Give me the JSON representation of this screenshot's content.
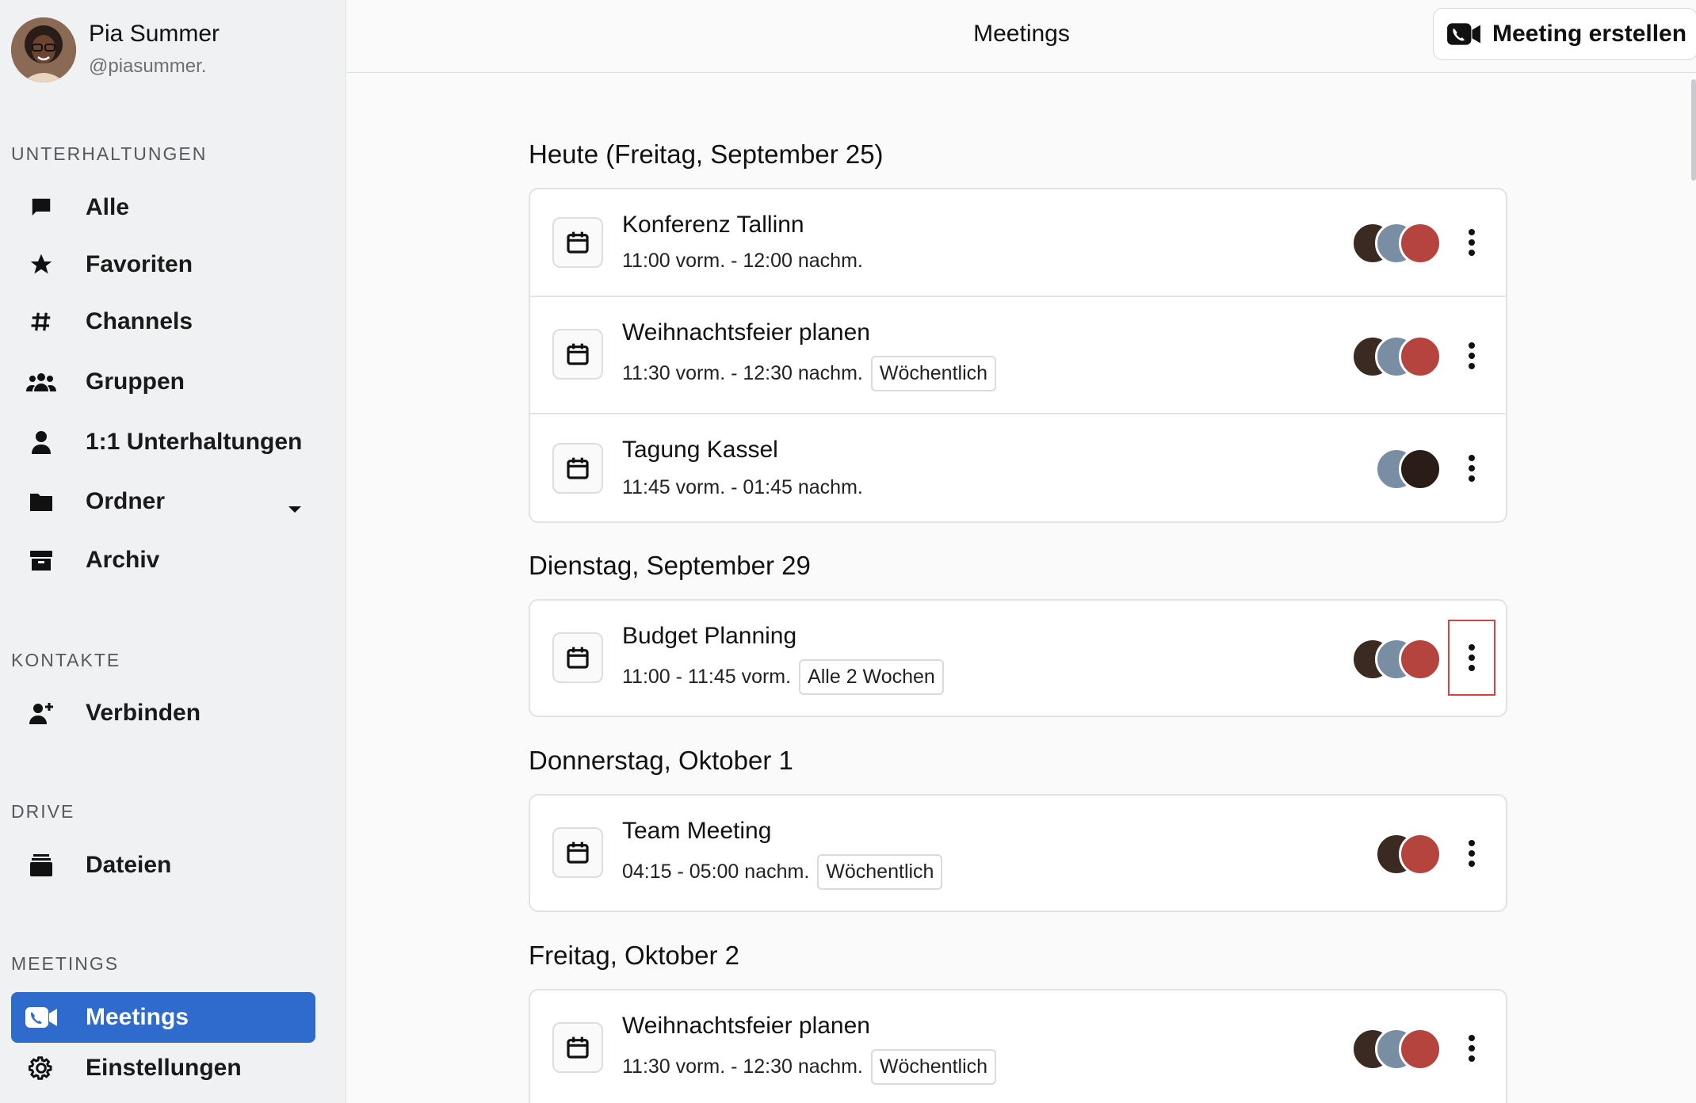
{
  "profile": {
    "name": "Pia Summer",
    "handle": "@piasummer."
  },
  "sidebar": {
    "sections": {
      "conversations": "UNTERHALTUNGEN",
      "contacts": "KONTAKTE",
      "drive": "DRIVE",
      "meetings": "MEETINGS"
    },
    "items": [
      {
        "label": "Alle",
        "icon": "chat-bubble-icon"
      },
      {
        "label": "Favoriten",
        "icon": "star-icon"
      },
      {
        "label": "Channels",
        "icon": "hash-icon"
      },
      {
        "label": "Gruppen",
        "icon": "group-icon"
      },
      {
        "label": "1:1 Unterhaltungen",
        "icon": "person-icon"
      },
      {
        "label": "Ordner",
        "icon": "folder-icon"
      },
      {
        "label": "Archiv",
        "icon": "archive-icon"
      },
      {
        "label": "Verbinden",
        "icon": "add-person-icon"
      },
      {
        "label": "Dateien",
        "icon": "files-icon"
      },
      {
        "label": "Meetings",
        "icon": "video-call-icon",
        "active": true
      },
      {
        "label": "Einstellungen",
        "icon": "gear-icon"
      }
    ]
  },
  "header": {
    "title": "Meetings",
    "create_button": "Meeting erstellen"
  },
  "days": [
    {
      "title": "Heute (Freitag, September 25)",
      "meetings": [
        {
          "title": "Konferenz Tallinn",
          "time": "11:00 vorm. - 12:00 nachm.",
          "badge": ""
        },
        {
          "title": "Weihnachtsfeier planen",
          "time": "11:30 vorm. - 12:30 nachm.",
          "badge": "Wöchentlich"
        },
        {
          "title": "Tagung Kassel",
          "time": "11:45 vorm. - 01:45 nachm.",
          "badge": ""
        }
      ]
    },
    {
      "title": "Dienstag, September 29",
      "meetings": [
        {
          "title": "Budget Planning",
          "time": "11:00 - 11:45 vorm.",
          "badge": "Alle 2 Wochen"
        }
      ]
    },
    {
      "title": "Donnerstag, Oktober 1",
      "meetings": [
        {
          "title": "Team Meeting",
          "time": "04:15 - 05:00 nachm.",
          "badge": "Wöchentlich"
        }
      ]
    },
    {
      "title": "Freitag, Oktober 2",
      "meetings": [
        {
          "title": "Weihnachtsfeier planen",
          "time": "11:30 vorm. - 12:30 nachm.",
          "badge": "Wöchentlich"
        }
      ]
    }
  ],
  "colors": {
    "accent": "#2f6bcd",
    "sidebar_bg": "#f0f1f2",
    "highlight": "#d9413b"
  }
}
